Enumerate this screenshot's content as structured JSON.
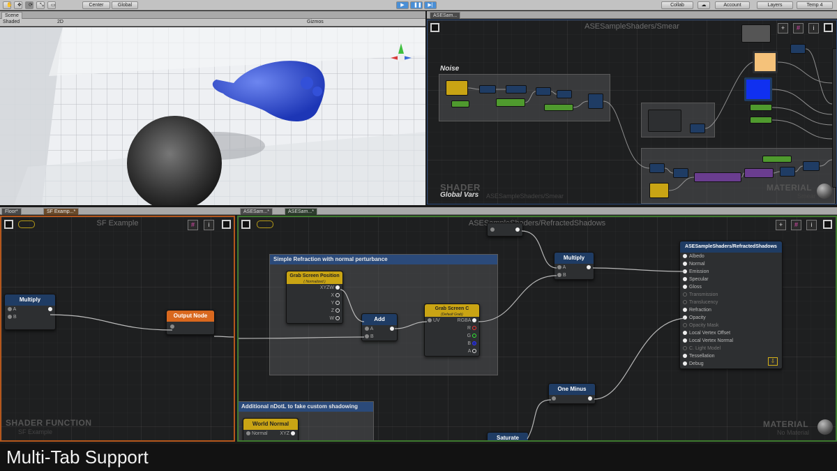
{
  "toolbar": {
    "center_label": "Center",
    "global_label": "Global",
    "collab_label": "Collab",
    "account_label": "Account",
    "layers_label": "Layers",
    "layout_label": "Temp 4"
  },
  "scene": {
    "tab_label": "Scene",
    "shading_label": "Shaded",
    "mode_2d": "2D",
    "gizmos_label": "Gizmos"
  },
  "smear_panel": {
    "tab_label": "ASESam...",
    "title": "ASESampleShaders/Smear",
    "group_noise": "Noise",
    "group_global_vars": "Global Vars",
    "watermark": "SHADER",
    "watermark_sub": "ASESampleShaders/Smear",
    "material_wm": "MATERIAL",
    "material_sub": "Smear"
  },
  "sf_panel": {
    "tab_floor": "Floor*",
    "tab_sf": "SF Examp...*",
    "title": "SF Example",
    "multiply_node": {
      "title": "Multiply",
      "ports": [
        "A",
        "B"
      ]
    },
    "output_node": {
      "title": "Output Node"
    },
    "watermark": "SHADER FUNCTION",
    "watermark_sub": "SF Example"
  },
  "refract_panel": {
    "tab1": "ASESam...*",
    "tab2": "ASESam...*",
    "title": "ASESampleShaders/RefractedShadows",
    "group_title": "Simple Refraction with normal perturbance",
    "group2_title": "Additional nDotL to fake custom shadowing",
    "grab_pos": {
      "title": "Grab Screen Position",
      "subtitle": "( Normalized )",
      "ports": [
        "XYZW",
        "X",
        "Y",
        "Z",
        "W"
      ]
    },
    "add_node": {
      "title": "Add",
      "ports": [
        "A",
        "B"
      ]
    },
    "grab_color": {
      "title": "Grab Screen C",
      "subtitle": "(Default Grab)",
      "in_port": "UV",
      "ports": [
        "RGBA",
        "R",
        "G",
        "B",
        "A"
      ]
    },
    "multiply_node": {
      "title": "Multiply",
      "ports": [
        "A",
        "B"
      ]
    },
    "one_minus": {
      "title": "One Minus"
    },
    "saturate": {
      "title": "Saturate"
    },
    "world_normal": {
      "title": "World Normal",
      "in_port": "Normal",
      "out_port": "XYZ"
    },
    "output": {
      "title": "ASESampleShaders/RefractedShadows",
      "ports": [
        "Albedo",
        "Normal",
        "Emission",
        "Specular",
        "Gloss",
        "Transmission",
        "Translucency",
        "Refraction",
        "Opacity",
        "Opacity Mask",
        "Local Vertex Offset",
        "Local Vertex Normal",
        "C. Light Model",
        "Tessellation",
        "Debug"
      ]
    },
    "material_wm": "MATERIAL",
    "material_sub": "No Material"
  },
  "caption": "Multi-Tab Support",
  "colors": {
    "accent_blue": "#1f3c64",
    "node_yellow": "#c9a414",
    "node_orange": "#d9681e",
    "panel_bg": "#1e1f20"
  }
}
